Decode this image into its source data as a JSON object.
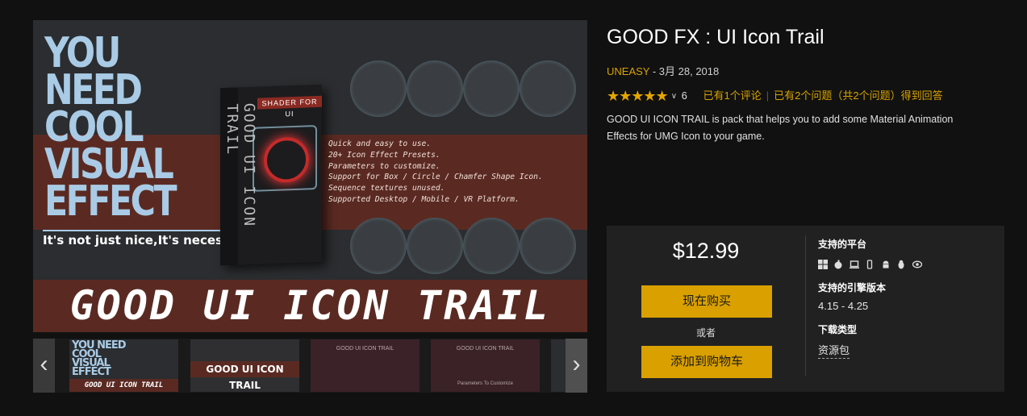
{
  "gallery": {
    "hero": {
      "headline": "YOU NEED COOL VISUAL EFFECT",
      "tagline": "It's not just nice,It's necessary",
      "box_side_text": "GOOD UI ICON TRAIL",
      "box_tag": "SHADER FOR UI",
      "features": [
        "Quick and easy to use.",
        "20+ Icon Effect Presets.",
        "Parameters to customize.",
        "Support for Box / Circle / Chamfer Shape Icon.",
        "Sequence textures unused.",
        "Supported Desktop / Mobile / VR Platform."
      ],
      "title": "GOOD UI ICON TRAIL"
    },
    "thumbnails": {
      "prev_icon": "chevron-left-icon",
      "next_icon": "chevron-right-icon",
      "t1_headline": "YOU NEED COOL VISUAL EFFECT",
      "t1_bar": "GOOD UI ICON TRAIL",
      "t2_bar": "GOOD UI ICON TRAIL",
      "t3_caption": "GOOD UI ICON TRAIL",
      "t4_caption": "GOOD UI ICON TRAIL",
      "t4_bottom": "Parameters To Customize"
    }
  },
  "product": {
    "title": "GOOD FX : UI Icon Trail",
    "seller": "UNEASY",
    "date": " - 3月 28, 2018",
    "stars": "★★★★★",
    "rating_count": "6",
    "reviews_link": "已有1个评论",
    "questions_link": "已有2个问题（共2个问题）得到回答",
    "description": "GOOD UI ICON TRAIL is pack that helps you to add some Material Animation Effects for UMG Icon to your game."
  },
  "purchase": {
    "price": "$12.99",
    "buy_now": "现在购买",
    "or": "或者",
    "add_to_cart": "添加到购物车",
    "platforms_heading": "支持的平台",
    "platform_icons": [
      "windows-icon",
      "apple-icon",
      "laptop-icon",
      "ios-icon",
      "android-icon",
      "linux-icon",
      "vr-icon"
    ],
    "engine_heading": "支持的引擎版本",
    "engine_versions": "4.15 - 4.25",
    "download_heading": "下载类型",
    "download_type": "资源包"
  },
  "colors": {
    "accent": "#d9a000",
    "seller": "#d8a300",
    "background": "#111111",
    "panel": "#212121"
  }
}
